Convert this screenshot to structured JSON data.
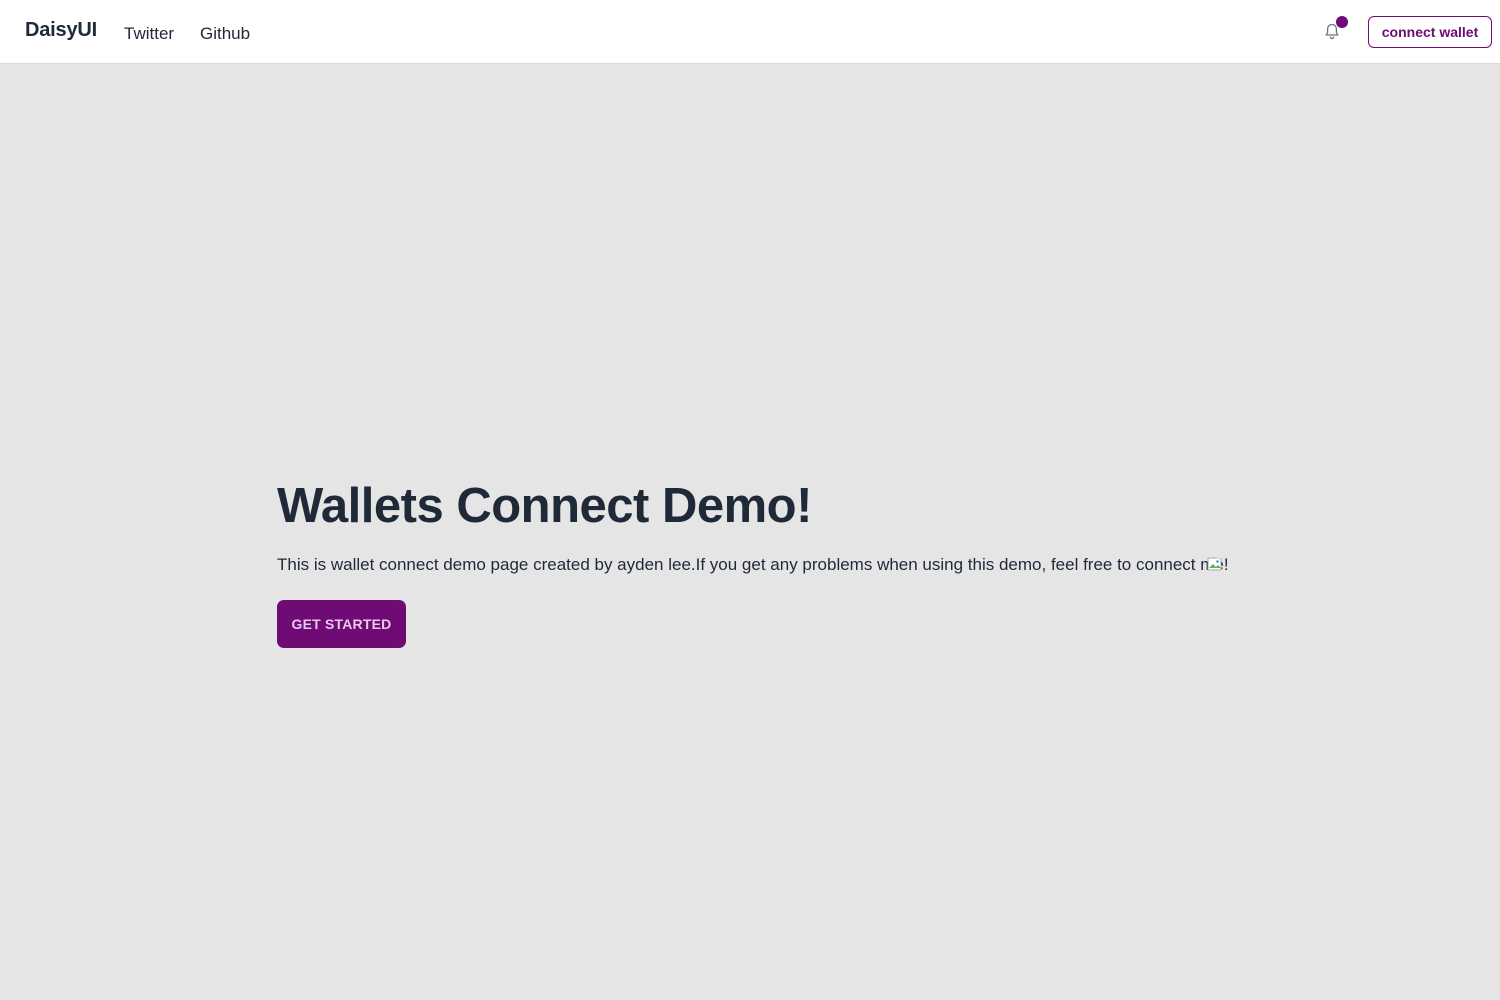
{
  "navbar": {
    "brand": "DaisyUI",
    "links": [
      {
        "label": "Twitter"
      },
      {
        "label": "Github"
      }
    ],
    "notification_icon": "bell-icon",
    "connect_label": "connect wallet"
  },
  "hero": {
    "title": "Wallets Connect Demo!",
    "description": "This is wallet connect demo page created by ayden lee.If you get any problems when using this demo, feel free to connect me!",
    "image_icon": "broken-image-icon",
    "cta_label": "GET STARTED"
  },
  "colors": {
    "primary": "#6e0b75",
    "background": "#e5e5e5",
    "navbar_bg": "#ffffff",
    "text": "#1f2937",
    "cta_text": "#ecc8ee"
  }
}
